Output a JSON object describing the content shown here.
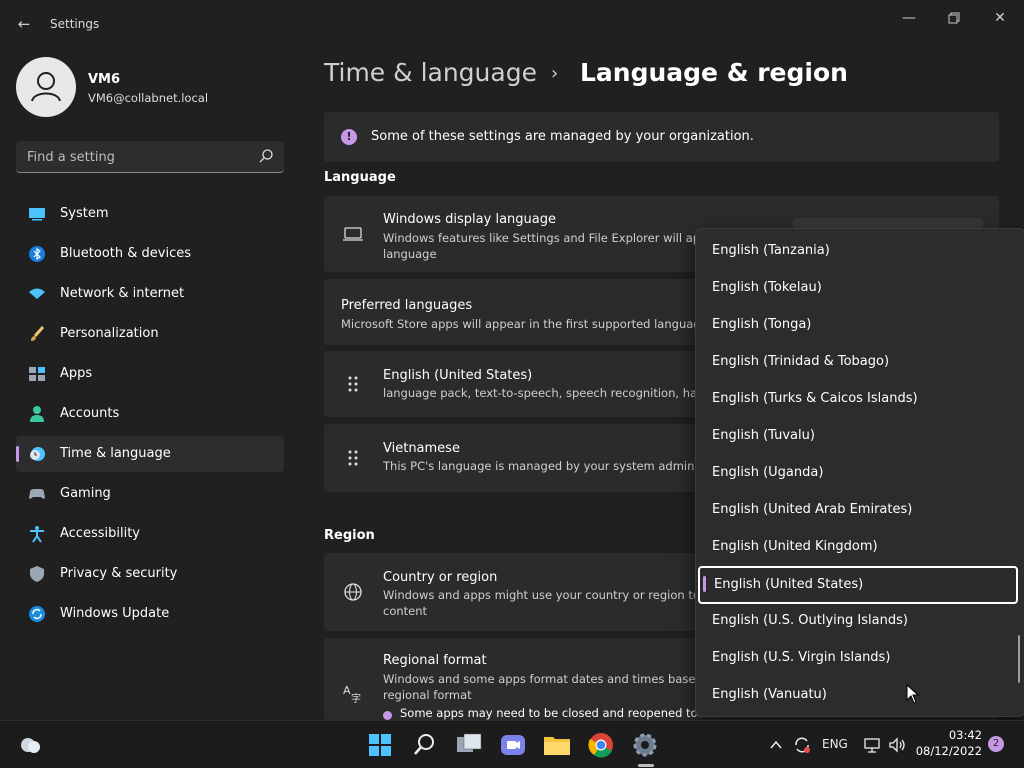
{
  "app": {
    "title": "Settings"
  },
  "profile": {
    "name": "VM6",
    "email": "VM6@collabnet.local"
  },
  "search": {
    "placeholder": "Find a setting"
  },
  "sidebar": {
    "items": [
      {
        "label": "System",
        "icon": "system-icon"
      },
      {
        "label": "Bluetooth & devices",
        "icon": "bluetooth-icon"
      },
      {
        "label": "Network & internet",
        "icon": "network-icon"
      },
      {
        "label": "Personalization",
        "icon": "brush-icon"
      },
      {
        "label": "Apps",
        "icon": "apps-icon"
      },
      {
        "label": "Accounts",
        "icon": "accounts-icon"
      },
      {
        "label": "Time & language",
        "icon": "time-language-icon",
        "selected": true
      },
      {
        "label": "Gaming",
        "icon": "gaming-icon"
      },
      {
        "label": "Accessibility",
        "icon": "accessibility-icon"
      },
      {
        "label": "Privacy & security",
        "icon": "shield-icon"
      },
      {
        "label": "Windows Update",
        "icon": "update-icon"
      }
    ]
  },
  "breadcrumb": {
    "parent": "Time & language",
    "separator": "›",
    "current": "Language & region"
  },
  "banner": {
    "text": "Some of these settings are managed by your organization."
  },
  "language": {
    "header": "Language",
    "display": {
      "title": "Windows display language",
      "subtitle1": "Windows features like Settings and File Explorer will appea",
      "subtitle2": "language"
    },
    "preferred": {
      "title": "Preferred languages",
      "subtitle": "Microsoft Store apps will appear in the first supported language i"
    },
    "english": {
      "title": "English (United States)",
      "subtitle": "language pack, text-to-speech, speech recognition, handw"
    },
    "vietnamese": {
      "title": "Vietnamese",
      "subtitle": "This PC's language is managed by your system admin"
    }
  },
  "region": {
    "header": "Region",
    "country": {
      "title": "Country or region",
      "subtitle1": "Windows and apps might use your country or region to g",
      "subtitle2": "content"
    },
    "format": {
      "title": "Regional format",
      "subtitle1": "Windows and some apps format dates and times based o",
      "subtitle2": "regional format",
      "note": "Some apps may need to be closed and reopened to se"
    }
  },
  "dropdown": {
    "options": [
      "English (Tanzania)",
      "English (Tokelau)",
      "English (Tonga)",
      "English (Trinidad & Tobago)",
      "English (Turks & Caicos Islands)",
      "English (Tuvalu)",
      "English (Uganda)",
      "English (United Arab Emirates)",
      "English (United Kingdom)",
      "English (United States)",
      "English (U.S. Outlying Islands)",
      "English (U.S. Virgin Islands)",
      "English (Vanuatu)"
    ],
    "selected": "English (United States)"
  },
  "taskbar": {
    "apps": [
      "start-icon",
      "search-icon",
      "task-view-icon",
      "teams-chat-icon",
      "file-explorer-icon",
      "chrome-icon",
      "settings-icon"
    ],
    "input_language": "ENG",
    "time": "03:42",
    "date": "08/12/2022",
    "notifications": "2"
  },
  "colors": {
    "accent": "#c797e6",
    "background": "#202020",
    "card": "#2b2b2b"
  }
}
